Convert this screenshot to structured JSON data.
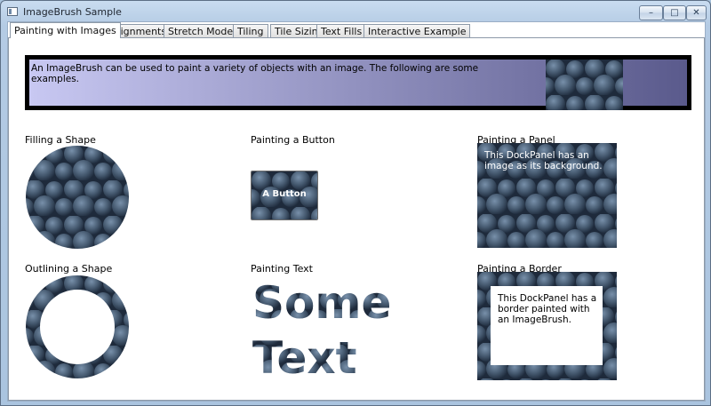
{
  "window": {
    "title": "ImageBrush Sample",
    "controls": {
      "minimize": "–",
      "maximize": "□",
      "close": "✕"
    }
  },
  "tabs": [
    {
      "label": "Painting with Images",
      "active": true
    },
    {
      "label": "Alignments",
      "active": false
    },
    {
      "label": "Stretch Modes",
      "active": false
    },
    {
      "label": "Tiling",
      "active": false
    },
    {
      "label": "Tile Sizing",
      "active": false
    },
    {
      "label": "Text Fills",
      "active": false
    },
    {
      "label": "Interactive Example",
      "active": false
    }
  ],
  "intro": {
    "text": "An ImageBrush can be used to paint a variety of objects with an image. The following are some examples."
  },
  "samples": {
    "filling_shape": {
      "caption": "Filling a Shape"
    },
    "painting_button": {
      "caption": "Painting a Button",
      "button_label": "A Button"
    },
    "painting_panel": {
      "caption": "Painting a Panel",
      "text": "This DockPanel has an image as its background."
    },
    "outlining_shape": {
      "caption": "Outlining a Shape"
    },
    "painting_text": {
      "caption": "Painting Text",
      "line1": "Some",
      "line2": "Text"
    },
    "painting_border": {
      "caption": "Painting a Border",
      "text": "This DockPanel has a border painted with an ImageBrush."
    }
  },
  "colors": {
    "intro_gradient_start": "#c8c8f2",
    "intro_gradient_end": "#5a5a8c",
    "image_base": "#24334a",
    "image_grape": "#42566e"
  }
}
